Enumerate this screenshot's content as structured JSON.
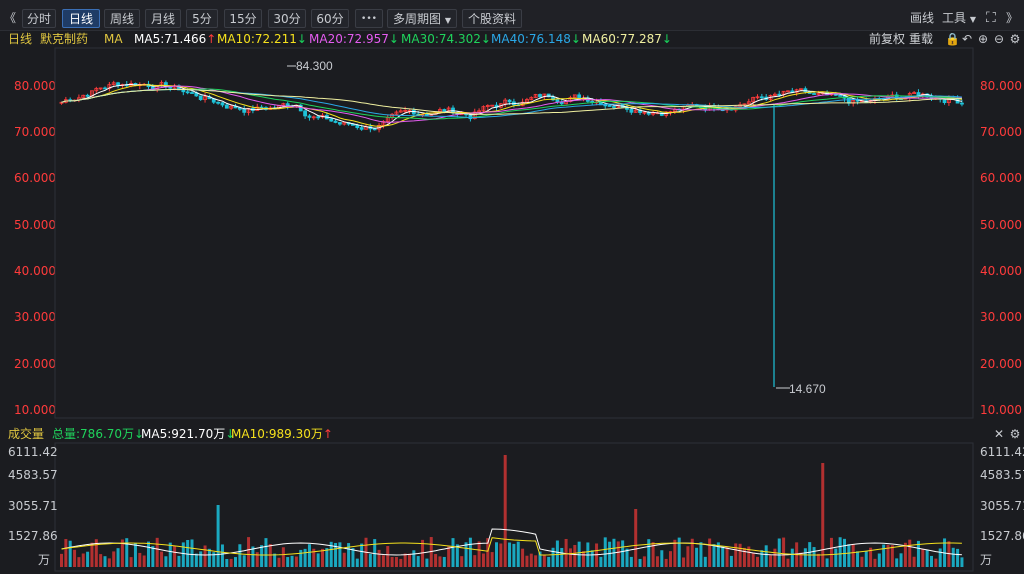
{
  "toolbar": {
    "collapse_left": "《",
    "tabs": [
      "分时",
      "日线",
      "周线",
      "月线",
      "5分",
      "15分",
      "30分",
      "60分"
    ],
    "active_tab": "日线",
    "more": "•••",
    "multi_period": "多周期图",
    "stock_info": "个股资料",
    "draw": "画线",
    "tools": "工具",
    "expand_right": "》"
  },
  "info": {
    "period": "日线",
    "stock_name": "默克制药",
    "ma_label": "MA",
    "ma5": "MA5:71.466",
    "ma10": "MA10:72.211",
    "ma20": "MA20:72.957",
    "ma30": "MA30:74.302",
    "ma40": "MA40:76.148",
    "ma60": "MA60:77.287",
    "adjust": "前复权",
    "overlay": "重载"
  },
  "colors": {
    "ma5": "#ffffff",
    "ma10": "#f5e11d",
    "ma20": "#e45cf0",
    "ma30": "#1fd35c",
    "ma40": "#2aa7e6",
    "ma60": "#f0f0a0",
    "up": "#ff3b3b",
    "down": "#1ec3d9"
  },
  "price_axis": {
    "ticks": [
      "80.000",
      "70.000",
      "60.000",
      "50.000",
      "40.000",
      "30.000",
      "20.000",
      "10.000"
    ],
    "high_marker": "84.300",
    "low_marker": "14.670"
  },
  "volume": {
    "label": "成交量",
    "total": "总量:786.70万",
    "ma5": "MA5:921.70万",
    "ma10": "MA10:989.30万",
    "ticks": [
      "6111.42",
      "4583.57",
      "3055.71",
      "1527.86"
    ],
    "unit": "万"
  },
  "chart_data": {
    "type": "candlestick",
    "price_ylim": [
      10,
      84.3
    ],
    "price_ticks": [
      80,
      70,
      60,
      50,
      40,
      30,
      20,
      10
    ],
    "high": 84.3,
    "low": 14.67,
    "volume_ticks": [
      6111.42,
      4583.57,
      3055.71,
      1527.86
    ],
    "volume_unit": "万"
  }
}
